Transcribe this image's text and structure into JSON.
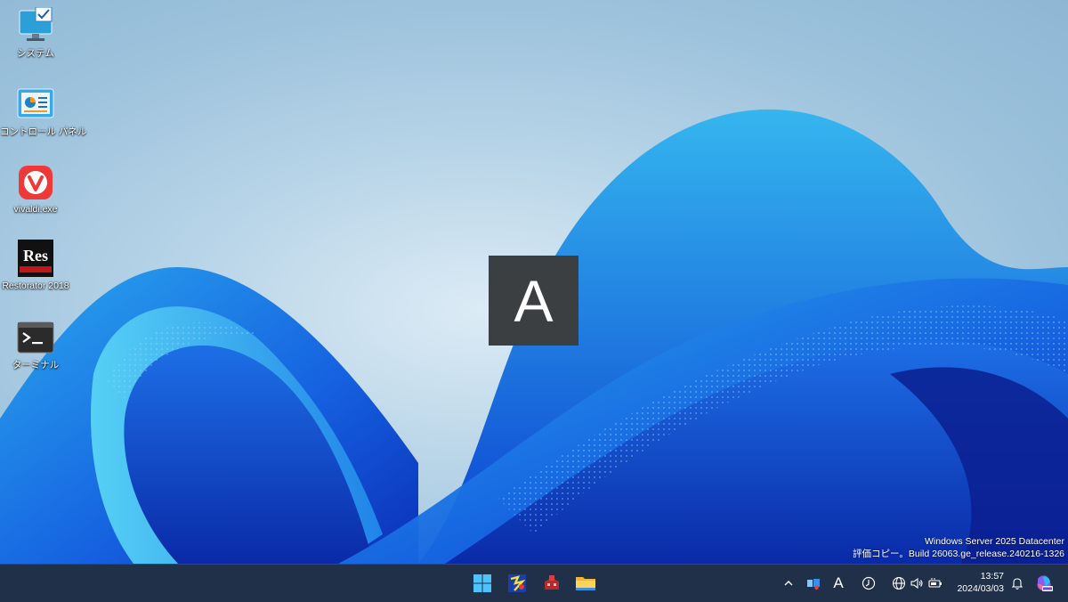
{
  "desktop": {
    "icons": [
      {
        "label": "システム",
        "icon": "monitor-check-icon"
      },
      {
        "label": "コントロール パネル",
        "icon": "control-panel-icon"
      },
      {
        "label": "vivaldi.exe",
        "icon": "vivaldi-icon"
      },
      {
        "label": "Restorator 2018",
        "icon": "restorator-icon"
      },
      {
        "label": "ターミナル",
        "icon": "terminal-icon"
      }
    ],
    "restorator_logo_text": "Res",
    "ime_indicator": "A",
    "watermark": {
      "line1": "Windows Server 2025 Datacenter",
      "line2": "評価コピー。Build 26063.ge_release.240216-1326"
    }
  },
  "taskbar": {
    "pinned": [
      {
        "name": "start-button",
        "icon": "windows-logo-icon"
      },
      {
        "name": "app-button-1",
        "icon": "app-icon"
      },
      {
        "name": "app-button-2",
        "icon": "app-icon"
      },
      {
        "name": "file-explorer-button",
        "icon": "folder-icon"
      }
    ],
    "tray": {
      "ime_mode": "A",
      "time": "13:57",
      "date": "2024/03/03"
    }
  },
  "colors": {
    "taskbar_bg": "#203048",
    "ime_bg": "#3b3f42"
  }
}
